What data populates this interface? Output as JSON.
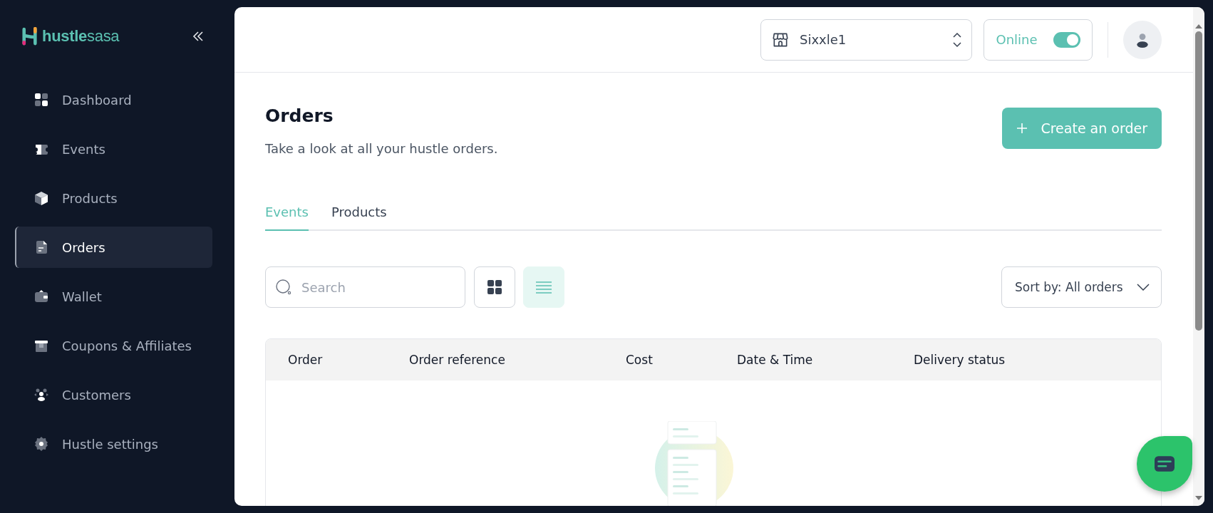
{
  "sidebar": {
    "logo": {
      "part_1": "hustle",
      "part_2": "sasa"
    },
    "items": [
      {
        "label": "Dashboard",
        "selected": false
      },
      {
        "label": "Events",
        "selected": false
      },
      {
        "label": "Products",
        "selected": false
      },
      {
        "label": "Orders",
        "selected": true
      },
      {
        "label": "Wallet",
        "selected": false
      },
      {
        "label": "Coupons & Affiliates",
        "selected": false
      },
      {
        "label": "Customers",
        "selected": false
      },
      {
        "label": "Hustle settings",
        "selected": false
      }
    ]
  },
  "header": {
    "store": "Sixxle1",
    "status": {
      "label": "Online",
      "on": true
    }
  },
  "page": {
    "title": "Orders",
    "subtitle": "Take a look at all your hustle orders.",
    "create_button": "Create an order"
  },
  "tabs": [
    {
      "label": "Events",
      "selected": true
    },
    {
      "label": "Products",
      "selected": false
    }
  ],
  "toolbar": {
    "search": {
      "placeholder": "Search"
    },
    "views": [
      {
        "kind": "grid",
        "selected": false
      },
      {
        "kind": "list",
        "selected": true
      }
    ],
    "sort": "Sort by: All orders"
  },
  "table": {
    "columns": [
      "Order",
      "Order reference",
      "Cost",
      "Date & Time",
      "Delivery status"
    ]
  }
}
